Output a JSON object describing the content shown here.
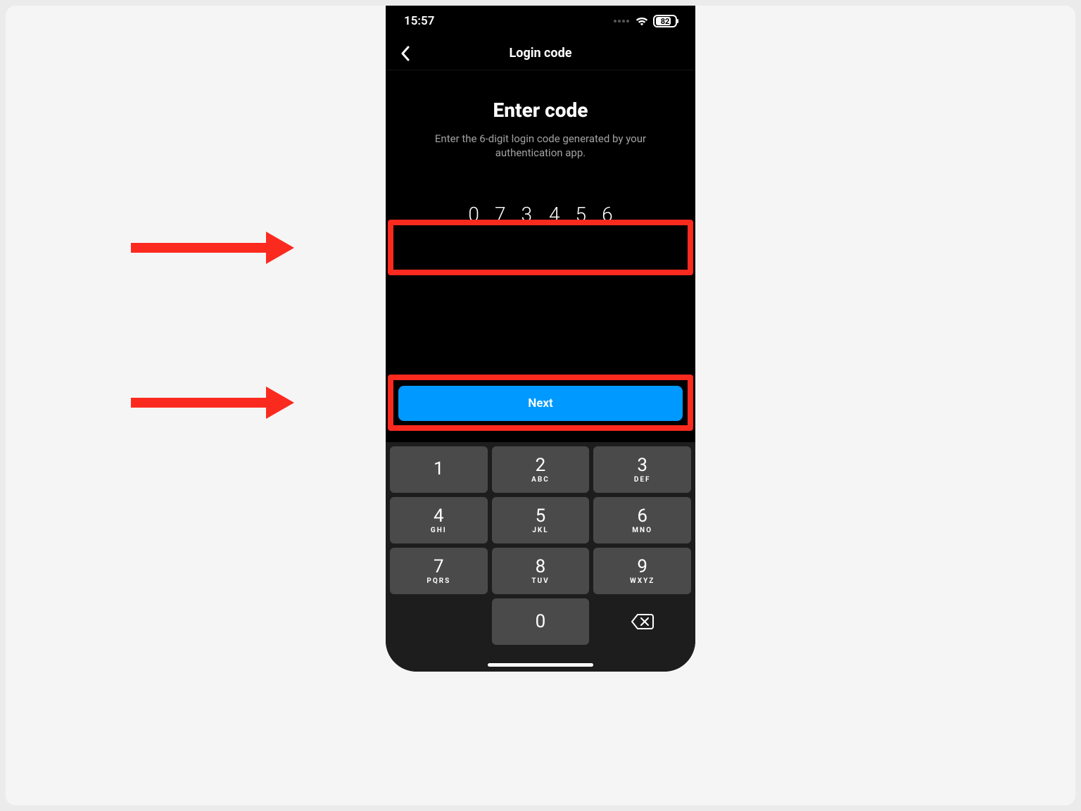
{
  "status": {
    "time": "15:57",
    "battery_percent": "82",
    "battery_fill_pct": 82
  },
  "nav": {
    "title": "Login code"
  },
  "main": {
    "heading": "Enter code",
    "subtext": "Enter the 6-digit login code generated by your authentication app."
  },
  "code": {
    "digits": [
      "0",
      "7",
      "3",
      "4",
      "5",
      "6"
    ]
  },
  "actions": {
    "next_label": "Next"
  },
  "keypad": {
    "keys": [
      {
        "num": "1",
        "let": ""
      },
      {
        "num": "2",
        "let": "ABC"
      },
      {
        "num": "3",
        "let": "DEF"
      },
      {
        "num": "4",
        "let": "GHI"
      },
      {
        "num": "5",
        "let": "JKL"
      },
      {
        "num": "6",
        "let": "MNO"
      },
      {
        "num": "7",
        "let": "PQRS"
      },
      {
        "num": "8",
        "let": "TUV"
      },
      {
        "num": "9",
        "let": "WXYZ"
      },
      {
        "num": "",
        "let": ""
      },
      {
        "num": "0",
        "let": ""
      },
      {
        "num": "⌫",
        "let": ""
      }
    ]
  },
  "annotations": {
    "highlight_color": "#fb2a1f"
  }
}
